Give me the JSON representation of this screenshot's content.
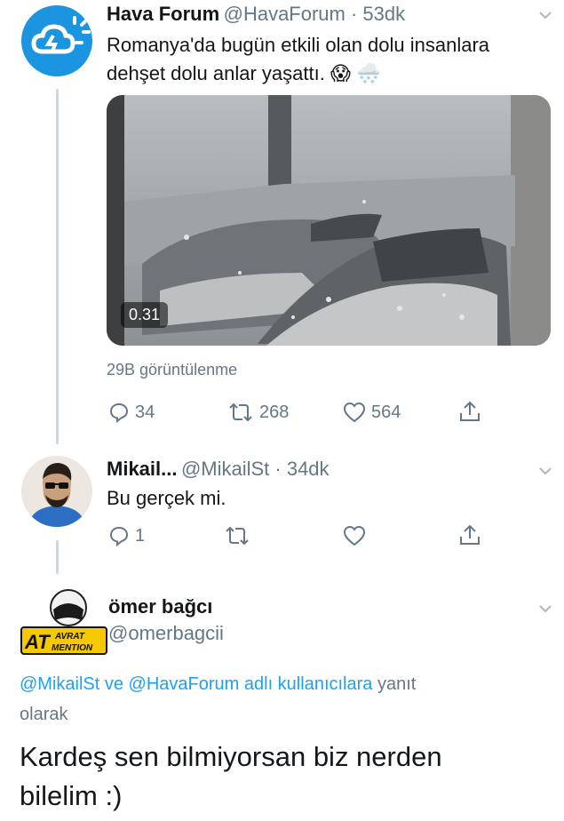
{
  "tweet1": {
    "author_name": "Hava Forum",
    "handle_time": "@HavaForum · 53dk",
    "text_line1": "Romanya'da bugün etkili olan dolu insanlara",
    "text_line2": "dehşet dolu anlar yaşattı.",
    "emoji1": "😱",
    "emoji2": "🌨️",
    "video_duration": "0.31",
    "views": "29B görüntülenme",
    "replies": "34",
    "retweets": "268",
    "likes": "564"
  },
  "tweet2": {
    "author_name": "Mikail...",
    "handle_time": "@MikailSt · 34dk",
    "text": "Bu gerçek mi.",
    "replies": "1"
  },
  "tweet3": {
    "author_name": "ömer bağcı",
    "handle": "@omerbagcii",
    "avatar_logo_text": "AT AVRAT MENTION",
    "reply_to_mentions": "@MikailSt ve @HavaForum adlı kullanıcılara",
    "reply_to_suffix": "yanıt",
    "reply_to_line2": "olarak",
    "text_line1": "Kardeş sen bilmiyorsan biz nerden",
    "text_line2": "bilelim :)"
  },
  "colors": {
    "accent": "#1da1f2",
    "muted": "#657786",
    "thread": "#ccd6dd"
  }
}
